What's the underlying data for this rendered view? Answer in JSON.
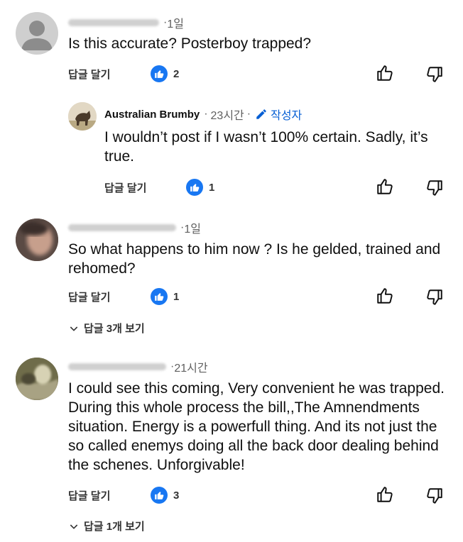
{
  "comments": [
    {
      "author": "",
      "time": "1일",
      "text": "Is this accurate? Posterboy trapped?",
      "reply_label": "답글 달기",
      "likes": "2",
      "replies": [
        {
          "author": "Australian Brumby",
          "time": "23시간",
          "creator_badge": "작성자",
          "text": "I wouldn’t post if I wasn’t  100% certain. Sadly, it’s true.",
          "reply_label": "답글 달기",
          "likes": "1"
        }
      ]
    },
    {
      "author": "",
      "time": "1일",
      "text": "So what happens to him now ? Is he gelded, trained and rehomed?",
      "reply_label": "답글 달기",
      "likes": "1",
      "show_replies": "답글 3개 보기"
    },
    {
      "author": "",
      "time": "21시간",
      "text": "I could see this coming, Very convenient he was trapped. During this whole process the bill,,The Amnendments situation. Energy is a powerfull thing. And its not just the so called enemys doing all the back door dealing behind the schenes. Unforgivable!",
      "reply_label": "답글 달기",
      "likes": "3",
      "show_replies": "답글 1개 보기"
    }
  ],
  "icons": {
    "like": "thumbs-up-icon",
    "dislike": "thumbs-down-icon",
    "like_badge": "blue-like-badge-icon",
    "expand": "chevron-down-icon",
    "creator": "pencil-icon"
  },
  "colors": {
    "like_badge": "#1877f2",
    "creator_badge": "#065fd4",
    "meta_text": "#606060"
  }
}
